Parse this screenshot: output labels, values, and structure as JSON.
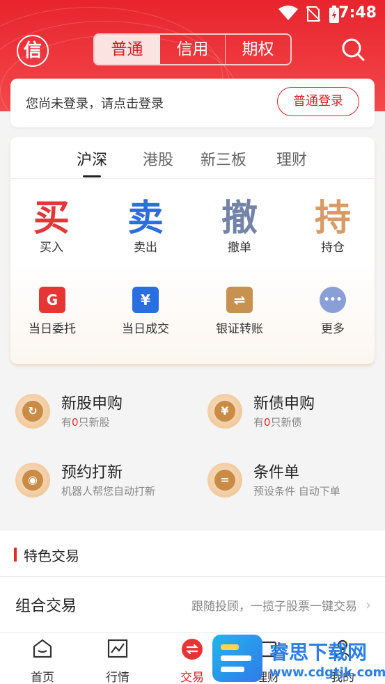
{
  "status": {
    "time": "7:48"
  },
  "header": {
    "logo_char": "信",
    "segments": [
      "普通",
      "信用",
      "期权"
    ],
    "active_segment": "普通"
  },
  "login": {
    "prompt": "您尚未登录，请点击登录",
    "button": "普通登录"
  },
  "market_tabs": [
    "沪深",
    "港股",
    "新三板",
    "理财"
  ],
  "primary_actions": [
    {
      "char": "买",
      "label": "买入",
      "color": "#e53535"
    },
    {
      "char": "卖",
      "label": "卖出",
      "color": "#2a6fe0"
    },
    {
      "char": "撤",
      "label": "撤单",
      "color": "#7384a8"
    },
    {
      "char": "持",
      "label": "持仓",
      "color": "#d99b63"
    }
  ],
  "secondary_actions": [
    {
      "glyph": "G",
      "label": "当日委托",
      "color": "#e53535"
    },
    {
      "glyph": "¥",
      "label": "当日成交",
      "color": "#2a6fe0"
    },
    {
      "glyph": "⇌",
      "label": "银证转账",
      "color": "#c7914f"
    },
    {
      "glyph": "•••",
      "label": "更多",
      "color": "#8a9fd6"
    }
  ],
  "features": [
    {
      "title": "新股申购",
      "sub_pre": "有",
      "sub_num": "0",
      "sub_post": "只新股",
      "glyph": "↻"
    },
    {
      "title": "新债申购",
      "sub_pre": "有",
      "sub_num": "0",
      "sub_post": "只新债",
      "glyph": "¥"
    },
    {
      "title": "预约打新",
      "sub": "机器人帮您自动打新",
      "glyph": "◉"
    },
    {
      "title": "条件单",
      "sub": "预设条件 自动下单",
      "glyph": "="
    }
  ],
  "special": {
    "heading": "特色交易",
    "row_title": "组合交易",
    "row_sub": "跟随投顾，一揽子股票一键交易"
  },
  "bottom_nav": [
    {
      "label": "首页",
      "icon": "home-icon"
    },
    {
      "label": "行情",
      "icon": "chart-icon"
    },
    {
      "label": "交易",
      "icon": "exchange-icon"
    },
    {
      "label": "理财",
      "icon": "wallet-icon"
    },
    {
      "label": "我的",
      "icon": "user-icon"
    }
  ],
  "watermark": {
    "title": "睿思下载网",
    "url": "www.cdgtjk.com"
  }
}
